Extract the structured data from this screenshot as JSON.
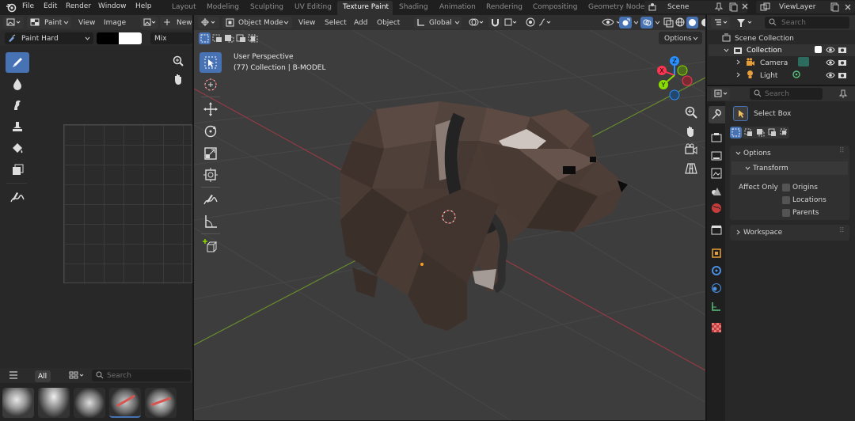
{
  "topbar": {
    "menus": [
      "File",
      "Edit",
      "Render",
      "Window",
      "Help"
    ],
    "workspaces": [
      "Layout",
      "Modeling",
      "Sculpting",
      "UV Editing",
      "Texture Paint",
      "Shading",
      "Animation",
      "Rendering",
      "Compositing",
      "Geometry Node"
    ],
    "active_workspace": "Texture Paint",
    "scene": "Scene",
    "view_layer": "ViewLayer"
  },
  "image_editor": {
    "mode": "Paint",
    "menus": [
      "View",
      "Image"
    ],
    "new_label": "New",
    "brush": "Paint Hard",
    "blend": "Mix",
    "filter_all": "All",
    "search_placeholder": "Search"
  },
  "viewport": {
    "mode": "Object Mode",
    "menus": [
      "View",
      "Select",
      "Add",
      "Object"
    ],
    "orientation": "Global",
    "options_label": "Options",
    "overlay_line1": "User Perspective",
    "overlay_line2": "(77) Collection | B-MODEL",
    "gizmo": {
      "x": "X",
      "y": "Y",
      "z": "Z"
    }
  },
  "outliner": {
    "search_placeholder": "Search",
    "scene_collection": "Scene Collection",
    "items": [
      "Collection",
      "Camera",
      "Light"
    ]
  },
  "properties": {
    "search_placeholder": "Search",
    "tool": "Select Box",
    "options_panel": "Options",
    "transform_sub": "Transform",
    "affect_only": "Affect Only",
    "checks": [
      "Origins",
      "Locations",
      "Parents"
    ],
    "workspace_panel": "Workspace"
  },
  "colors": {
    "accent": "#4772b3",
    "header": "#303030",
    "viewport_bg": "#3d3d3d",
    "x_axis": "#ff3352",
    "y_axis": "#8bdc00",
    "z_axis": "#2890ff"
  }
}
